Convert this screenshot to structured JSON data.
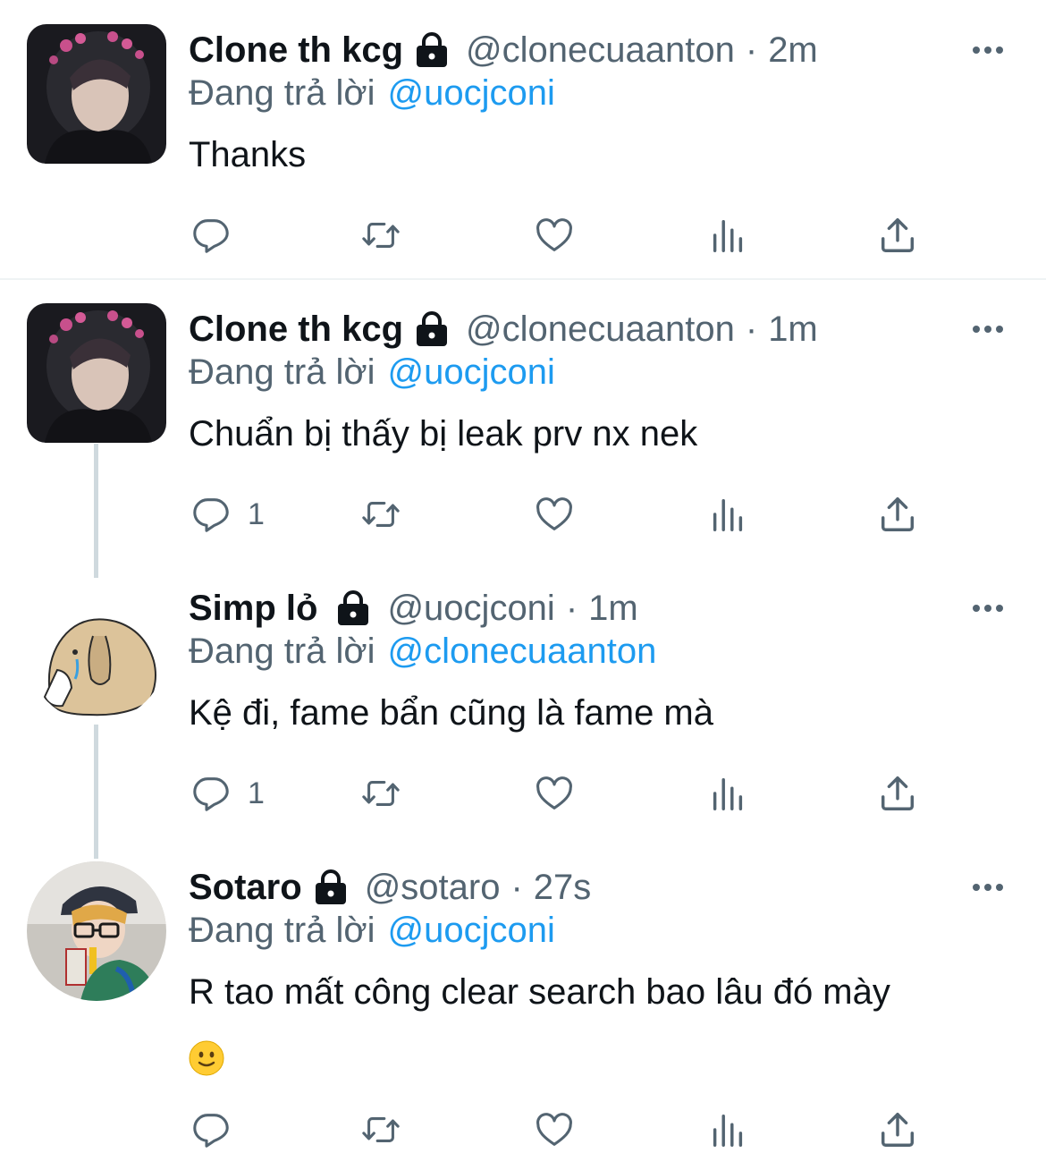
{
  "tweets": [
    {
      "name": "Clone th kcg",
      "handle": "@clonecuaanton",
      "sep": "·",
      "time": "2m",
      "replying_label": "Đang trả lời",
      "replying_to": "@uocjconi",
      "text": "Thanks",
      "reply_count": ""
    },
    {
      "name": "Clone th kcg",
      "handle": "@clonecuaanton",
      "sep": "·",
      "time": "1m",
      "replying_label": "Đang trả lời",
      "replying_to": "@uocjconi",
      "text": "Chuẩn bị thấy bị leak prv nx nek",
      "reply_count": "1"
    },
    {
      "name": "Simp lỏ",
      "handle": "@uocjconi",
      "sep": "·",
      "time": "1m",
      "replying_label": "Đang trả lời",
      "replying_to": "@clonecuaanton",
      "text": "Kệ đi, fame bẩn cũng là fame mà",
      "reply_count": "1"
    },
    {
      "name": "Sotaro",
      "handle": "@sotaro",
      "sep": "·",
      "time": "27s",
      "replying_label": "Đang trả lời",
      "replying_to": "@uocjconi",
      "text": "R tao mất công clear search bao lâu đó mày",
      "emoji": "slightly-smiling-face",
      "reply_count": ""
    }
  ],
  "icons": {
    "protected": "lock-icon",
    "more": "more-icon",
    "reply": "reply-icon",
    "retweet": "retweet-icon",
    "like": "heart-icon",
    "views": "views-icon",
    "share": "share-icon"
  },
  "colors": {
    "mention": "#1d9bf0",
    "secondary_text": "#536471",
    "primary_text": "#0f1419",
    "icon": "#536471",
    "divider": "#eff3f4",
    "thread_line": "#cfd9de"
  }
}
